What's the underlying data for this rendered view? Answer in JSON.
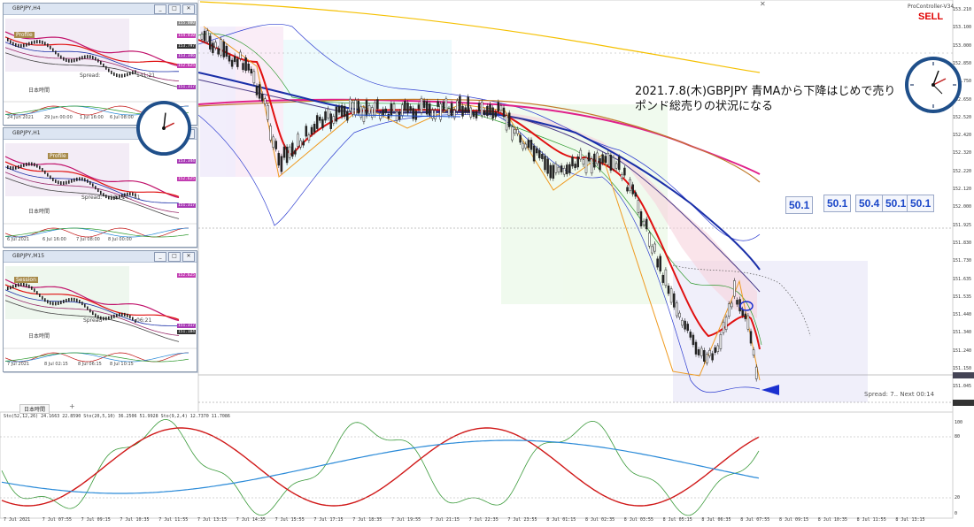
{
  "chart": {
    "provider": "ProController-V34",
    "signal": "SELL",
    "annotation_line1": "2021.7.8(木)GBPJPY  青MAから下降はじめで売り",
    "annotation_line2": "ポンド総売りの状況になる",
    "badges": [
      "50.1",
      "50.1",
      "50.4",
      "50.1",
      "50.1"
    ],
    "spread_text": "Spread: 7..  Next 00:14",
    "tab_label": "日本時間",
    "osc_header": "Sto(52,12,26) 24.1663 22.8590  Sto(20,5,10) 36.2506 51.9928  Sto(9,2,4) 12.7370 11.7086",
    "price_scale": [
      "153.210",
      "153.100",
      "153.000",
      "152.850",
      "152.750",
      "152.650",
      "152.520",
      "152.420",
      "152.320",
      "152.220",
      "152.120",
      "152.000",
      "151.925",
      "151.830",
      "151.730",
      "151.635",
      "151.535",
      "151.440",
      "151.340",
      "151.240",
      "151.150",
      "151.045",
      "150.950"
    ],
    "osc_scale": [
      "100",
      "80",
      "20",
      "0"
    ],
    "time_axis": [
      "7 Jul 2021",
      "7 Jul 07:55",
      "7 Jul 09:15",
      "7 Jul 10:35",
      "7 Jul 11:55",
      "7 Jul 13:15",
      "7 Jul 14:35",
      "7 Jul 15:55",
      "7 Jul 17:15",
      "7 Jul 18:35",
      "7 Jul 19:55",
      "7 Jul 21:15",
      "7 Jul 22:35",
      "7 Jul 23:55",
      "8 Jul 01:15",
      "8 Jul 02:35",
      "8 Jul 03:55",
      "8 Jul 05:15",
      "8 Jul 06:35",
      "8 Jul 07:55",
      "8 Jul 09:15",
      "8 Jul 10:35",
      "8 Jul 11:55",
      "8 Jul 13:15"
    ],
    "colors": {
      "ma_blue": "#1a2fa8",
      "ma_red": "#e01010",
      "ma_magenta": "#e0208a",
      "ma_brown": "#c07a2a",
      "ma_gold": "#f5c000",
      "sell": "#e00000",
      "arrow": "#1a30d0"
    }
  },
  "windows": [
    {
      "title": "GBPJPY,H4",
      "tag": "Profile",
      "spread_label": "Spread:",
      "time_left": "141:21",
      "tab": "日本時間",
      "prices": [
        "155.000",
        "154.410",
        "154.000",
        "153.797",
        "153.600",
        "153.346",
        "153.000",
        "152.625",
        "151.317",
        "151.000"
      ],
      "dates": [
        "24 Jun 2021",
        "29 Jun 00:00",
        "1 Jul 16:00",
        "6 Jul 08:00"
      ]
    },
    {
      "title": "GBPJPY,H1",
      "tag": "Profile",
      "spread_label": "Spread:",
      "time_left": "12 : 14 : 41",
      "tab": "日本時間",
      "prices": [
        "154.000",
        "153.344",
        "153.000",
        "152.625",
        "152.000",
        "151.750",
        "151.317",
        "151.000"
      ],
      "dates": [
        "6 Jul 2021",
        "6 Jul 16:00",
        "7 Jul 08:00",
        "8 Jul 00:00"
      ]
    },
    {
      "title": "GBPJPY,M15",
      "tag": "Session",
      "spread_label": "Spread",
      "time_left": "06:21",
      "tab": "日本時間",
      "prices": [
        "152.750",
        "152.625",
        "152.310",
        "152.000",
        "151.879",
        "151.317",
        "151.184",
        "151.000"
      ],
      "dates": [
        "7 Jul 2021",
        "8 Jul 02:15",
        "8 Jul 06:15",
        "8 Jul 10:15"
      ]
    }
  ]
}
